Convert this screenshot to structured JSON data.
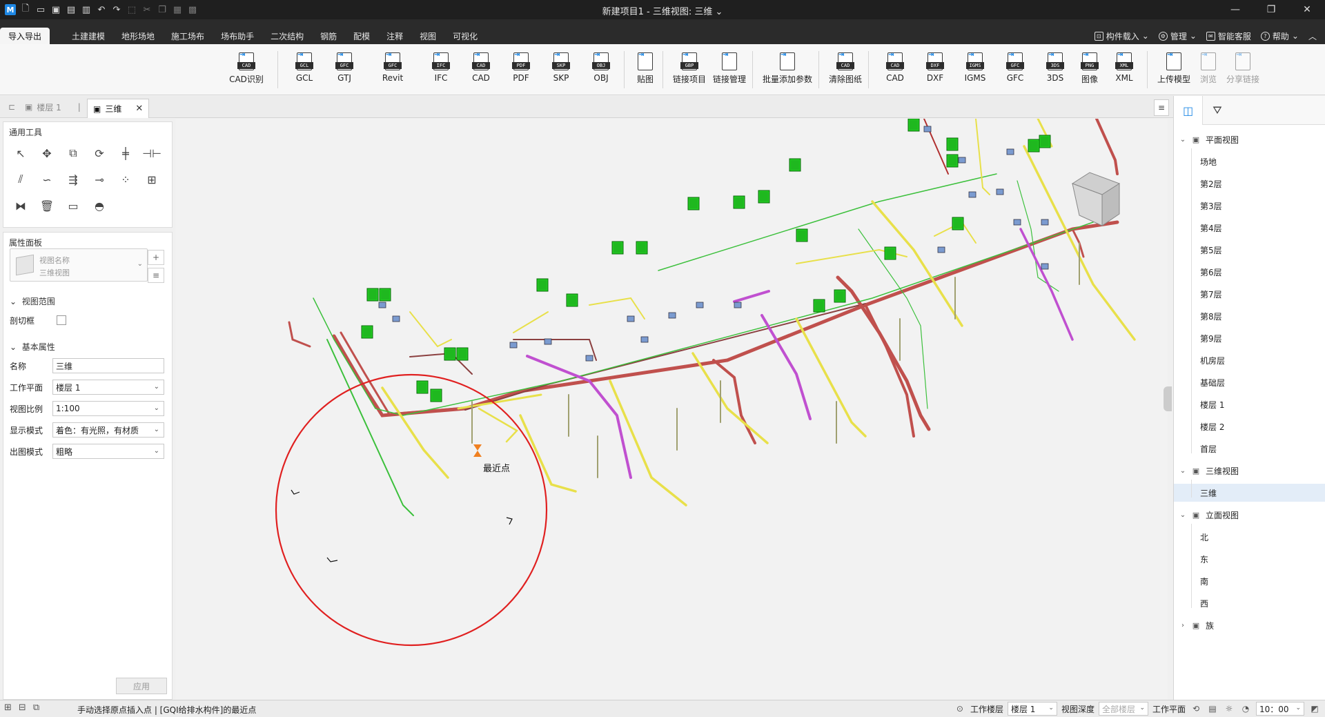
{
  "app": {
    "title": "新建项目1 - 三维视图: 三维",
    "title_suffix": "⌄"
  },
  "menu": {
    "tabs": [
      "导入导出",
      "土建建模",
      "地形场地",
      "施工场布",
      "场布助手",
      "二次结构",
      "钢筋",
      "配模",
      "注释",
      "视图",
      "可视化"
    ],
    "active_tab": "导入导出",
    "right": {
      "component_load": "构件载入",
      "manage": "管理",
      "smart_service": "智能客服",
      "help": "帮助"
    }
  },
  "ribbon": {
    "groups": [
      [
        {
          "label": "CAD识别",
          "tag": "CAD"
        }
      ],
      [
        {
          "label": "GCL",
          "tag": "GCL"
        },
        {
          "label": "GTJ",
          "tag": "GFC"
        },
        {
          "label": "Revit",
          "tag": "GFC"
        },
        {
          "label": "IFC",
          "tag": "IFC"
        },
        {
          "label": "CAD",
          "tag": "CAD"
        },
        {
          "label": "PDF",
          "tag": "PDF"
        },
        {
          "label": "SKP",
          "tag": "SKP"
        },
        {
          "label": "OBJ",
          "tag": "OBJ"
        }
      ],
      [
        {
          "label": "贴图",
          "tag": ""
        }
      ],
      [
        {
          "label": "链接项目",
          "tag": "GBP"
        },
        {
          "label": "链接管理",
          "tag": ""
        }
      ],
      [
        {
          "label": "批量添加参数",
          "tag": ""
        }
      ],
      [
        {
          "label": "清除图纸",
          "tag": "CAD"
        }
      ],
      [
        {
          "label": "CAD",
          "tag": "CAD"
        },
        {
          "label": "DXF",
          "tag": "DXF"
        },
        {
          "label": "IGMS",
          "tag": "IGMS"
        },
        {
          "label": "GFC",
          "tag": "GFC"
        },
        {
          "label": "3DS",
          "tag": "3DS"
        },
        {
          "label": "图像",
          "tag": "PNG"
        },
        {
          "label": "XML",
          "tag": "XML"
        }
      ],
      [
        {
          "label": "上传模型",
          "tag": ""
        },
        {
          "label": "浏览",
          "tag": "",
          "disabled": true
        },
        {
          "label": "分享链接",
          "tag": "",
          "disabled": true
        }
      ]
    ]
  },
  "doc_tabs": {
    "tab1": "楼层 1",
    "tab2": "三维"
  },
  "left_panel": {
    "toolbox_title": "通用工具",
    "props_title": "属性面板",
    "view_name_label": "视图名称",
    "view_name_value": "三维视图",
    "section_range": "视图范围",
    "section_basic": "基本属性",
    "crop_label": "剖切框",
    "rows": [
      {
        "label": "名称",
        "value": "三维",
        "dropdown": false
      },
      {
        "label": "工作平面",
        "value": "楼层 1",
        "dropdown": true
      },
      {
        "label": "视图比例",
        "value": "1:100",
        "dropdown": true
      },
      {
        "label": "显示模式",
        "value": "着色：有光照，有材质",
        "dropdown": true
      },
      {
        "label": "出图模式",
        "value": "粗略",
        "dropdown": true
      }
    ],
    "apply": "应用"
  },
  "viewport": {
    "snap_label": "最近点"
  },
  "tree": {
    "plan_views": "平面视图",
    "plan_items": [
      "场地",
      "第2层",
      "第3层",
      "第4层",
      "第5层",
      "第6层",
      "第7层",
      "第8层",
      "第9层",
      "机房层",
      "基础层",
      "楼层 1",
      "楼层 2",
      "首层"
    ],
    "views_3d": "三维视图",
    "items_3d": [
      "三维"
    ],
    "elevations": "立面视图",
    "elevation_items": [
      "北",
      "东",
      "南",
      "西"
    ],
    "family": "族"
  },
  "status": {
    "message": "手动选择原点插入点 | [GQI给排水构件]的最近点",
    "work_floor_label": "工作楼层",
    "work_floor_value": "楼层 1",
    "view_depth_label": "视图深度",
    "view_depth_value": "全部楼层",
    "work_plane_label": "工作平面",
    "time": "10：00"
  },
  "colors": {
    "accent": "#1e88e5",
    "pipe_red": "#c0504d",
    "pipe_yellow": "#e8e04a",
    "pipe_magenta": "#c050d0",
    "pipe_green": "#3cc03c",
    "device_green": "#22cc22",
    "circle_red": "#e02020"
  }
}
